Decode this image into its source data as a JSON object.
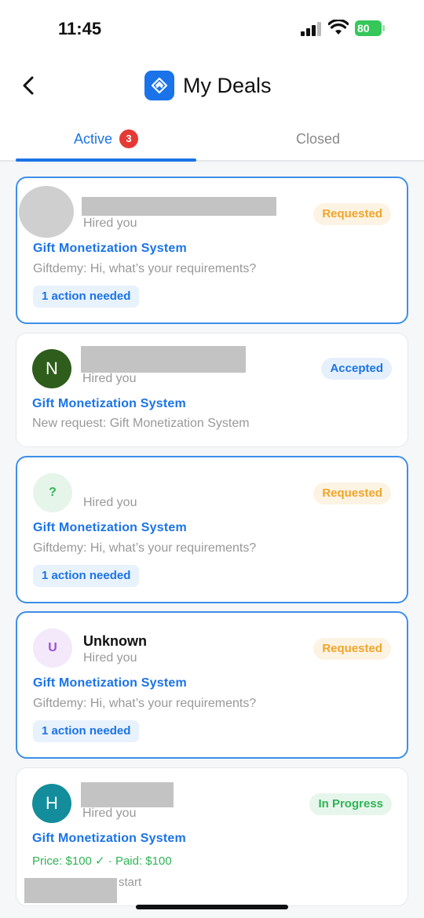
{
  "status_bar": {
    "time": "11:45",
    "battery": "80"
  },
  "header": {
    "title": "My Deals"
  },
  "tabs": {
    "active_label": "Active",
    "active_count": "3",
    "closed_label": "Closed"
  },
  "deals": [
    {
      "hired": "Hired you",
      "project": "Gift Monetization System",
      "message": "Giftdemy: Hi, what’s your requirements?",
      "action": "1 action needed",
      "status": "Requested"
    },
    {
      "initial": "N",
      "hired": "Hired you",
      "project": "Gift Monetization System",
      "message": "New request: Gift Monetization System",
      "status": "Accepted"
    },
    {
      "initial": "?",
      "hired": "Hired you",
      "project": "Gift Monetization System",
      "message": "Giftdemy: Hi, what’s your requirements?",
      "action": "1 action needed",
      "status": "Requested"
    },
    {
      "initial": "U",
      "name": "Unknown",
      "hired": "Hired you",
      "project": "Gift Monetization System",
      "message": "Giftdemy: Hi, what’s your requirements?",
      "action": "1 action needed",
      "status": "Requested"
    },
    {
      "initial": "H",
      "hired": "Hired you",
      "project": "Gift Monetization System",
      "price": "Price: $100 ✓ · Paid: $100",
      "start": "start",
      "status": "In Progress"
    }
  ],
  "colors": {
    "accent": "#1a73e8",
    "requested": "#f0a52a",
    "in_progress": "#2fb456",
    "badge": "#e53935"
  }
}
